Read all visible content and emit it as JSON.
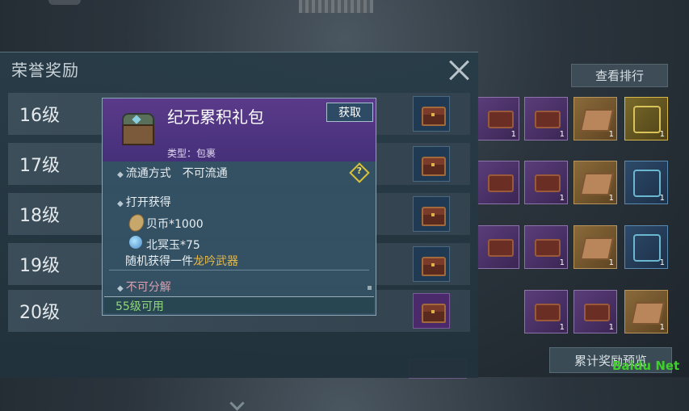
{
  "panel": {
    "title": "荣誉奖励",
    "rows": [
      {
        "label": "16级"
      },
      {
        "label": "17级"
      },
      {
        "label": "18级"
      },
      {
        "label": "19级"
      },
      {
        "label": "20级"
      }
    ]
  },
  "right": {
    "rank_button": "查看排行",
    "preview_button": "累计奖励预览",
    "slot_counts": [
      "1",
      "1",
      "1",
      "1",
      "1",
      "1",
      "1",
      "1",
      "1",
      "1",
      "1",
      "1",
      "1"
    ]
  },
  "tooltip": {
    "name": "纪元累积礼包",
    "get_button": "获取",
    "type": "类型：包裹",
    "circulation": "流通方式　不可流通",
    "open_title": "打开获得",
    "item1": "贝币*1000",
    "item2": "北冥玉*75",
    "random_prefix": "随机获得一件",
    "random_item": "龙吟武器",
    "no_split": "不可分解",
    "requirement": "55级可用",
    "colors": {
      "header": "#5a3a8a",
      "highlight": "#e7b84a",
      "requirement": "#8fd87a"
    }
  },
  "watermark": "Baidu Net"
}
